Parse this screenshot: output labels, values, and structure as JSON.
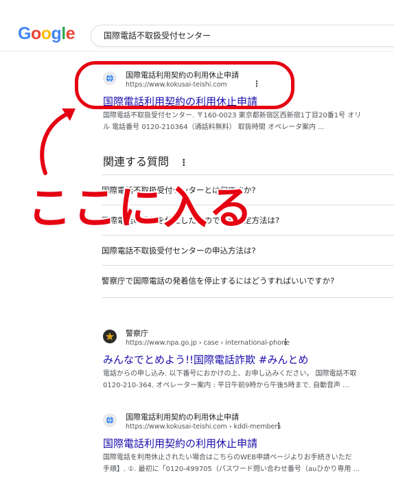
{
  "header": {
    "logo_letters": [
      "G",
      "o",
      "o",
      "g",
      "l",
      "e"
    ],
    "logo_colors": [
      "#4285F4",
      "#EA4335",
      "#FBBC05",
      "#4285F4",
      "#34A853",
      "#EA4335"
    ],
    "search_query": "国際電話不取扱受付センター"
  },
  "results": [
    {
      "site_name": "国際電話利用契約の利用休止申請",
      "url": "https://www.kokusai-teishi.com",
      "title": "国際電話利用契約の利用休止申請",
      "snippet": [
        "国際電話不取扱受付センター. 〒160-0023 東京都新宿区西新宿1丁目20番1号 オリ",
        "ル 電話番号 0120-210364（通話料無料） 取扱時間 オペレータ案内 ..."
      ]
    },
    {
      "site_name": "警察庁",
      "url": "https://www.npa.go.jp › case › international-phone",
      "title": "みんなでとめよう!!国際電話詐欺 #みんとめ",
      "snippet": [
        "電話からの申し込み. 以下番号におかけの上、お申し込みください。 国際電話不取",
        "0120-210-364. オペレーター案内 : 平日午前9時から午後5時まで. 自動音声 ..."
      ]
    },
    {
      "site_name": "国際電話利用契約の利用休止申請",
      "url": "https://www.kokusai-teishi.com › kddi-members",
      "title": "国際電話利用契約の利用休止申請",
      "snippet": [
        "国際電話を利用休止されたい場合はこちらのWEB申請ページよりお手続きいただ",
        "手順】. ①. 最初に「0120-499705（パスワード問い合わせ番号（auひかり専用 ..."
      ]
    }
  ],
  "paa": {
    "heading": "関連する質問",
    "questions": [
      "国際電話不取扱受付センターとは何ですか?",
      "国際電話の発信を休止したいのですが設定方法は?",
      "国際電話不取扱受付センターの申込方法は?",
      "警察庁で国際電話の発着信を停止するにはどうすればいいですか?"
    ]
  },
  "overlay": {
    "caption": "ここに入る",
    "accent_color": "#e50012"
  }
}
